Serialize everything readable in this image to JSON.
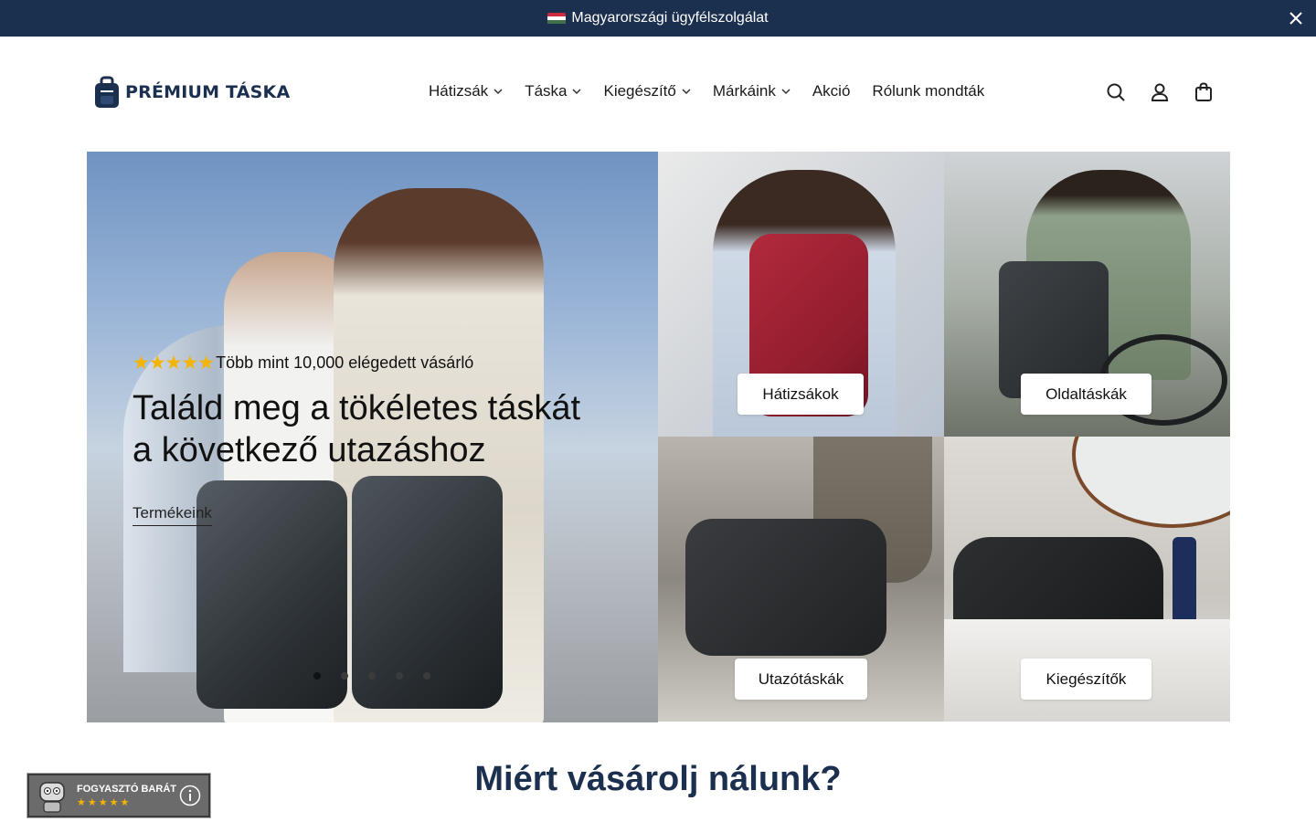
{
  "announcement": {
    "flag_colors": [
      "#cd2a3e",
      "#ffffff",
      "#436f4d"
    ],
    "text": "Magyarországi ügyfélszolgálat"
  },
  "header": {
    "logo_text": "PRÉMIUM TÁSKA",
    "nav": [
      {
        "label": "Hátizsák",
        "dropdown": true
      },
      {
        "label": "Táska",
        "dropdown": true
      },
      {
        "label": "Kiegészítő",
        "dropdown": true
      },
      {
        "label": "Márkáink",
        "dropdown": true
      },
      {
        "label": "Akció",
        "dropdown": false
      },
      {
        "label": "Rólunk mondták",
        "dropdown": false
      }
    ],
    "icons": [
      "search-icon",
      "account-icon",
      "cart-icon"
    ]
  },
  "hero": {
    "stars": "★★★★★",
    "rating_text": "Több mint 10,000 elégedett vásárló",
    "title": "Találd meg a tökéletes táskát a következő utazáshoz",
    "link": "Termékeink",
    "slide_count": 5,
    "active_slide": 1
  },
  "categories": [
    {
      "label": "Hátizsákok"
    },
    {
      "label": "Oldaltáskák"
    },
    {
      "label": "Utazótáskák"
    },
    {
      "label": "Kiegészítők"
    }
  ],
  "section_title": "Miért vásárolj nálunk?",
  "badge": {
    "line1": "FOGYASZTÓ BARÁT",
    "stars": "★★★★★"
  },
  "colors": {
    "brand": "#1b2f4e",
    "star": "#f5b400"
  }
}
